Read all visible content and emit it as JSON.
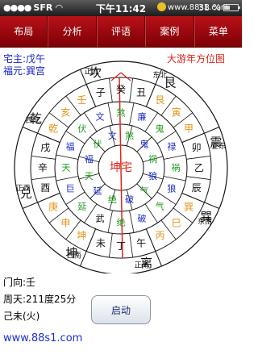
{
  "status_bar": {
    "carrier": "SFR",
    "time": "下午11:42",
    "battery_percent": "38 %",
    "battery_level": 0.38,
    "watermark": "www.88s1.com"
  },
  "nav": {
    "items": [
      "布局",
      "分析",
      "评语",
      "案例",
      "菜单"
    ]
  },
  "info": {
    "house_owner": "宅主:戊午",
    "fortune": "福元:巽宫",
    "title": "大游年方位图"
  },
  "compass": {
    "center_label": "坤宅",
    "directions": [
      "东北",
      "正东",
      "东南",
      "正南",
      "西南",
      "正西",
      "西北",
      "正北",
      "东北"
    ],
    "trigrams": [
      "坎",
      "艮",
      "震",
      "巽",
      "离",
      "坤",
      "兑",
      "乾"
    ],
    "mountains": [
      "子",
      "癸",
      "丑",
      "艮",
      "寅",
      "甲",
      "卯",
      "乙",
      "辰",
      "巽",
      "巳",
      "丙",
      "午",
      "丁",
      "未",
      "坤",
      "申",
      "庚",
      "酉",
      "辛",
      "戌",
      "乾",
      "亥",
      "壬"
    ],
    "stars_outer": [
      "武",
      "延",
      "巨",
      "天",
      "福",
      "伏",
      "文",
      "煞",
      "廉",
      "鬼",
      "禄",
      "祸",
      "狼",
      "气",
      "破",
      "绝"
    ],
    "stars_inner": [
      "绝",
      "延",
      "天",
      "福",
      "伏",
      "文",
      "煞",
      "鬼",
      "祸",
      "狼",
      "气",
      "破"
    ],
    "colors": {
      "red": "#e0241c",
      "green": "#1e9a1e",
      "blue": "#1c2cc8",
      "orange": "#e59418",
      "black": "#111111"
    }
  },
  "bottom": {
    "facing": "门向:壬",
    "degrees": "周天:211度25分",
    "year": "己未(火)",
    "start_label": "启动",
    "url": "www.88s1.com"
  }
}
